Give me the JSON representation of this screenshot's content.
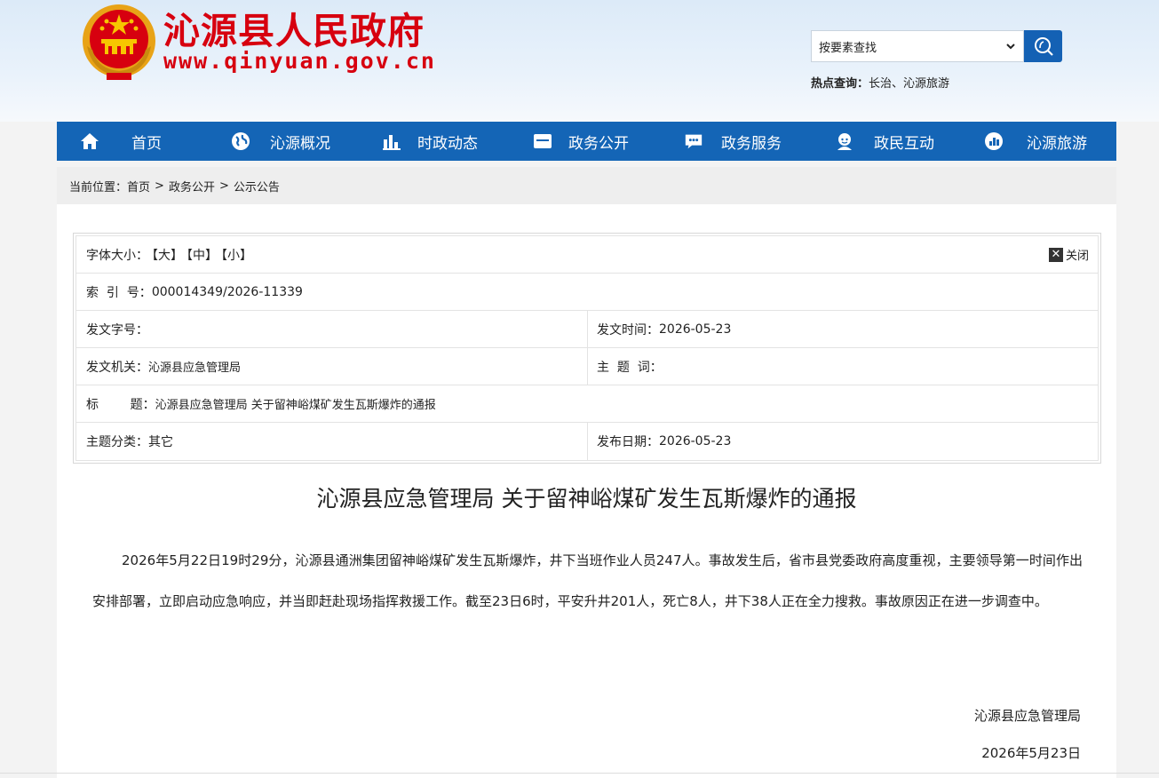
{
  "header": {
    "site_name": "沁源县人民政府",
    "site_url": "www.qinyuan.gov.cn",
    "search_select": "按要素查找",
    "hot_label": "热点查询：",
    "hot_links": [
      "长治",
      "沁源旅游"
    ],
    "hot_sep": "、"
  },
  "nav": {
    "items": [
      {
        "label": "首页",
        "icon": "home-icon"
      },
      {
        "label": "沁源概况",
        "icon": "globe-icon"
      },
      {
        "label": "时政动态",
        "icon": "bar-chart-icon"
      },
      {
        "label": "政务公开",
        "icon": "folder-icon"
      },
      {
        "label": "政务服务",
        "icon": "chat-icon"
      },
      {
        "label": "政民互动",
        "icon": "user-icon"
      },
      {
        "label": "沁源旅游",
        "icon": "tour-icon"
      }
    ]
  },
  "breadcrumb": {
    "prefix": "当前位置：",
    "items": [
      "首页",
      "政务公开",
      "公示公告"
    ],
    "sep": ">"
  },
  "info": {
    "font_size_label": "字体大小：",
    "font_large": "【大】",
    "font_medium": "【中】",
    "font_small": "【小】",
    "close_label": "关闭",
    "index_label": "索  引  号：",
    "index_value": "000014349/2026-11339",
    "doc_no_label": "发文字号：",
    "doc_no_value": "",
    "doc_time_label": "发文时间：",
    "doc_time_value": "2026-05-23",
    "issuer_label": "发文机关：",
    "issuer_value": "沁源县应急管理局",
    "keyword_label": "主  题  词：",
    "keyword_value": "",
    "title_label": "标        题：",
    "title_value": "沁源县应急管理局 关于留神峪煤矿发生瓦斯爆炸的通报",
    "category_label": "主题分类：",
    "category_value": "其它",
    "publish_label": "发布日期：",
    "publish_value": "2026-05-23"
  },
  "article": {
    "title": "沁源县应急管理局 关于留神峪煤矿发生瓦斯爆炸的通报",
    "body": "2026年5月22日19时29分，沁源县通洲集团留神峪煤矿发生瓦斯爆炸，井下当班作业人员247人。事故发生后，省市县党委政府高度重视，主要领导第一时间作出安排部署，立即启动应急响应，并当即赶赴现场指挥救援工作。截至23日6时，平安升井201人，死亡8人，井下38人正在全力搜救。事故原因正在进一步调查中。",
    "signature": "沁源县应急管理局",
    "date": "2026年5月23日"
  },
  "colors": {
    "brand_red": "#d7000f",
    "nav_blue": "#1465b6",
    "search_blue": "#1461b4"
  }
}
